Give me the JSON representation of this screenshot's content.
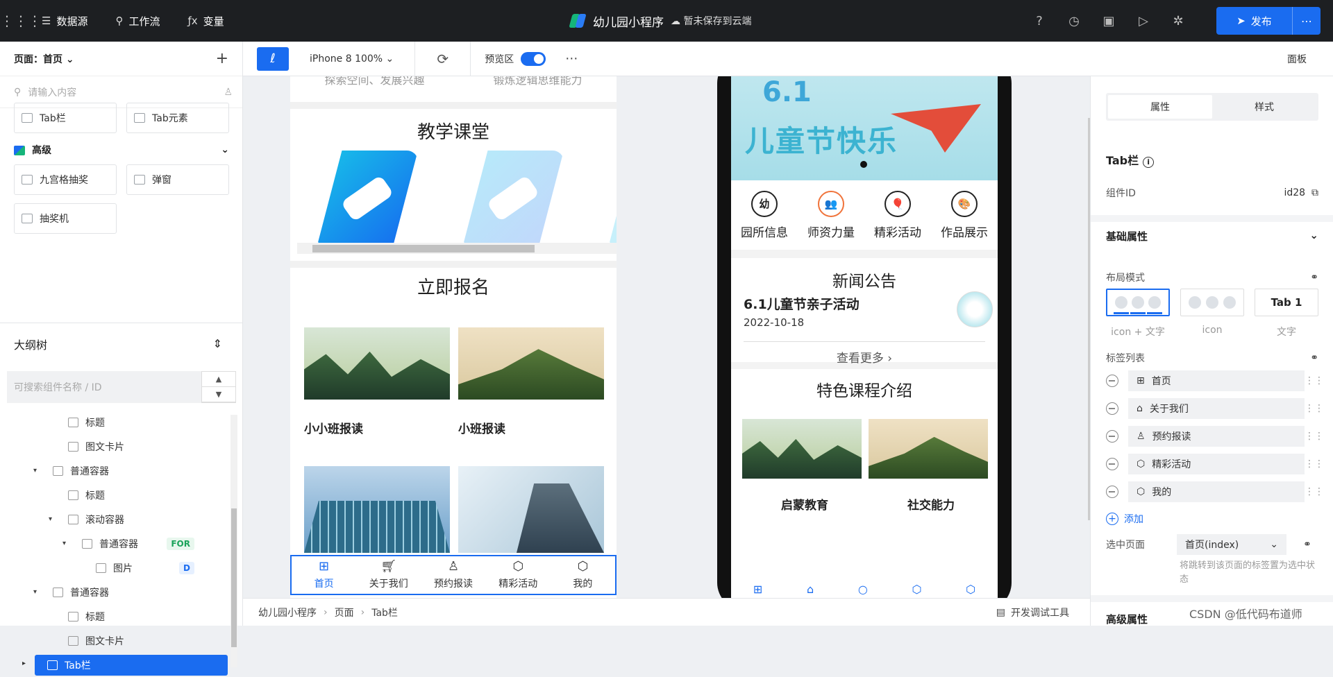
{
  "topbar": {
    "items": [
      {
        "icon": "database-icon",
        "label": "数据源"
      },
      {
        "icon": "workflow-icon",
        "label": "工作流"
      },
      {
        "icon": "fx-icon",
        "label": "变量"
      }
    ],
    "app_title": "幼儿园小程序",
    "save_status": "暂未保存到云端",
    "publish_label": "发布"
  },
  "left_panel": {
    "page_label": "页面：首页",
    "search_placeholder": "请输入内容",
    "components": [
      {
        "label": "Tab栏"
      },
      {
        "label": "Tab元素"
      }
    ],
    "advanced_title": "高级",
    "advanced_components": [
      {
        "label": "九宫格抽奖"
      },
      {
        "label": "弹窗"
      },
      {
        "label": "抽奖机"
      }
    ],
    "outline_title": "大纲树",
    "outline_search_placeholder": "可搜索组件名称 / ID",
    "tree": [
      {
        "label": "标题",
        "indent": 1
      },
      {
        "label": "图文卡片",
        "indent": 1
      },
      {
        "label": "普通容器",
        "indent": 0,
        "arrow": "▾"
      },
      {
        "label": "标题",
        "indent": 1
      },
      {
        "label": "滚动容器",
        "indent": 1,
        "arrow": "▾"
      },
      {
        "label": "普通容器",
        "indent": 2,
        "arrow": "▾",
        "badge": "FOR"
      },
      {
        "label": "图片",
        "indent": 3,
        "badge": "D"
      },
      {
        "label": "普通容器",
        "indent": 0,
        "arrow": "▾"
      },
      {
        "label": "标题",
        "indent": 1
      },
      {
        "label": "图文卡片",
        "indent": 1
      },
      {
        "label": "Tab栏",
        "indent": 0,
        "arrow": "▸",
        "selected": true
      }
    ]
  },
  "toolbar": {
    "device": "iPhone 8 100%",
    "preview_label": "预览区",
    "panel_label": "面板"
  },
  "editor": {
    "top_texts": [
      "探索空间、发展兴趣",
      "锻炼逻辑思维能力"
    ],
    "section1_title": "教学课堂",
    "section2_title": "立即报名",
    "cards": [
      "小小班报读",
      "小班报读"
    ],
    "tabs": [
      {
        "label": "首页",
        "icon": "home-grid-icon"
      },
      {
        "label": "关于我们",
        "icon": "cart-icon"
      },
      {
        "label": "预约报读",
        "icon": "user-icon"
      },
      {
        "label": "精彩活动",
        "icon": "cube-icon"
      },
      {
        "label": "我的",
        "icon": "cube-icon"
      }
    ]
  },
  "phone": {
    "banner_number": "6.1",
    "banner_text": "儿童节快乐",
    "icons": [
      {
        "label": "园所信息",
        "glyph": "幼"
      },
      {
        "label": "师资力量",
        "glyph": "👥"
      },
      {
        "label": "精彩活动",
        "glyph": "🎈"
      },
      {
        "label": "作品展示",
        "glyph": "🎨"
      }
    ],
    "news_title": "新闻公告",
    "news_item": "6.1儿童节亲子活动",
    "news_date": "2022-10-18",
    "news_more": "查看更多 ›",
    "feature_title": "特色课程介绍",
    "feature_cards": [
      "启蒙教育",
      "社交能力"
    ]
  },
  "right_panel": {
    "tabs": [
      "属性",
      "样式"
    ],
    "component_name": "Tab栏",
    "id_label": "组件ID",
    "id_value": "id28",
    "basic_props": "基础属性",
    "layout_mode": "布局模式",
    "layout_options": [
      "icon + 文字",
      "icon",
      "文字"
    ],
    "layout_text_sample": "Tab 1",
    "tab_list_label": "标签列表",
    "tab_items": [
      "首页",
      "关于我们",
      "预约报读",
      "精彩活动",
      "我的"
    ],
    "add_label": "添加",
    "selected_page_label": "选中页面",
    "selected_page_value": "首页(index)",
    "hint": "将跳转到该页面的标签置为选中状态",
    "advanced_props": "高级属性"
  },
  "bottombar": {
    "breadcrumb": [
      "幼儿园小程序",
      "页面",
      "Tab栏"
    ],
    "devtools_label": "开发调试工具"
  },
  "watermark": "CSDN @低代码布道师"
}
